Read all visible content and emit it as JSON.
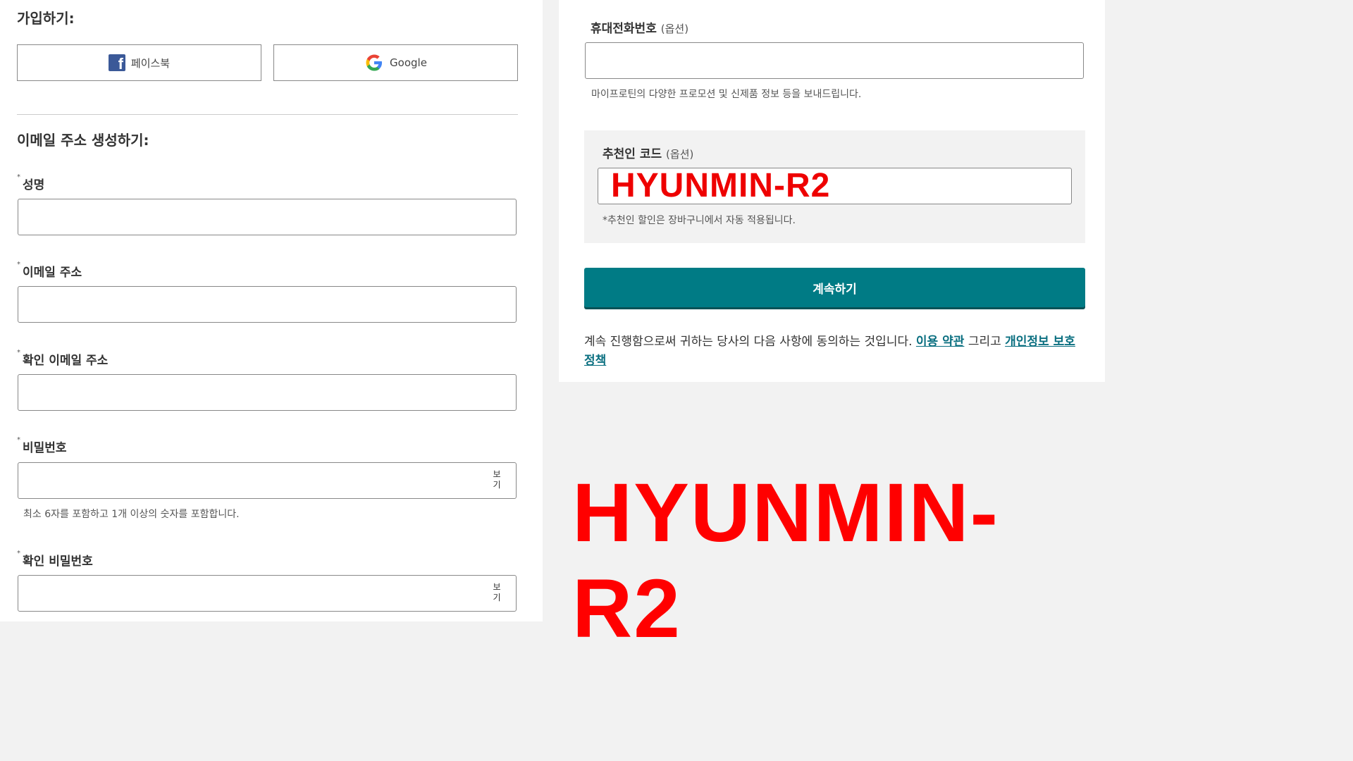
{
  "signup": {
    "title": "가입하기:",
    "facebook_label": "페이스북",
    "google_label": "Google"
  },
  "create": {
    "title": "이메일 주소 생성하기:",
    "required_mark": "*",
    "name_label": "성명",
    "email_label": "이메일 주소",
    "confirm_email_label": "확인 이메일 주소",
    "password_label": "비밀번호",
    "password_show": "보기",
    "password_hint": "최소 6자를 포함하고 1개 이상의 숫자를 포함합니다.",
    "confirm_password_label": "확인 비밀번호",
    "confirm_password_show": "보기"
  },
  "phone": {
    "label": "휴대전화번호",
    "optional": "(옵션)",
    "hint": "마이프로틴의 다양한 프로모션 및 신제품 정보 등을 보내드립니다."
  },
  "referral": {
    "label": "추천인 코드",
    "optional": "(옵션)",
    "value": "HYUNMIN-R2",
    "hint": "*추천인 할인은 장바구니에서 자동 적용됩니다."
  },
  "continue_label": "계속하기",
  "terms": {
    "text": "계속 진행함으로써 귀하는 당사의 다음 사항에 동의하는 것입니다.",
    "terms_link": "이용 약관",
    "and": "그리고",
    "privacy_link": "개인정보 보호정책"
  },
  "overlay_code": "HYUNMIN-R2",
  "colors": {
    "accent": "#007b85",
    "overlay_red": "#ff0000",
    "facebook": "#3b5998"
  }
}
